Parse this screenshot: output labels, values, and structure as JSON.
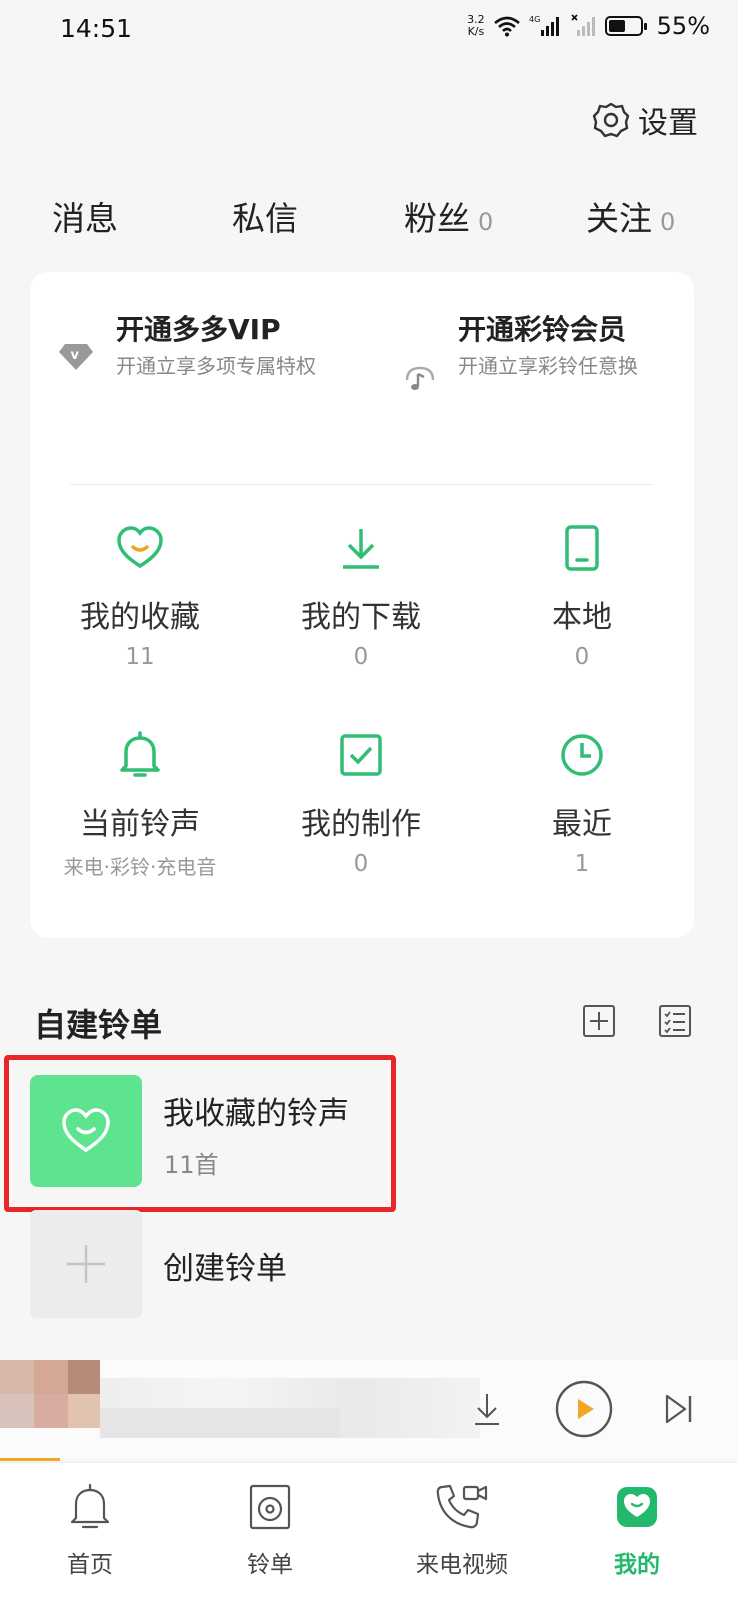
{
  "status_bar": {
    "time": "14:51",
    "speed_value": "3.2",
    "speed_unit": "K/s",
    "network": "4G",
    "battery": "55%"
  },
  "header": {
    "settings_label": "设置"
  },
  "top_nav": [
    {
      "label": "消息",
      "count": ""
    },
    {
      "label": "私信",
      "count": ""
    },
    {
      "label": "粉丝",
      "count": "0"
    },
    {
      "label": "关注",
      "count": "0"
    }
  ],
  "vip": {
    "duoduo": {
      "title": "开通多多VIP",
      "subtitle": "开通立享多项专属特权",
      "icon": "diamond-v-icon"
    },
    "caiLing": {
      "title": "开通彩铃会员",
      "subtitle": "开通立享彩铃任意换",
      "icon": "music-note-icon"
    }
  },
  "grid": [
    {
      "label": "我的收藏",
      "sub": "11",
      "icon": "heart-icon"
    },
    {
      "label": "我的下载",
      "sub": "0",
      "icon": "download-icon"
    },
    {
      "label": "本地",
      "sub": "0",
      "icon": "phone-icon"
    },
    {
      "label": "当前铃声",
      "sub": "来电·彩铃·充电音",
      "icon": "bell-icon"
    },
    {
      "label": "我的制作",
      "sub": "0",
      "icon": "check-box-icon"
    },
    {
      "label": "最近",
      "sub": "1",
      "icon": "clock-icon"
    }
  ],
  "playlists": {
    "section_title": "自建铃单",
    "items": [
      {
        "title": "我收藏的铃声",
        "count": "11首"
      }
    ],
    "create_label": "创建铃单"
  },
  "bottom_nav": [
    {
      "label": "首页",
      "icon": "bell-outline-icon",
      "active": false
    },
    {
      "label": "铃单",
      "icon": "disc-icon",
      "active": false
    },
    {
      "label": "来电视频",
      "icon": "phone-video-icon",
      "active": false
    },
    {
      "label": "我的",
      "icon": "profile-icon",
      "active": true
    }
  ],
  "colors": {
    "accent": "#22b96d",
    "cover_green": "#5ee38f",
    "highlight_red": "#e8262a",
    "play_orange": "#f2a623",
    "background": "#f6f6f6"
  }
}
